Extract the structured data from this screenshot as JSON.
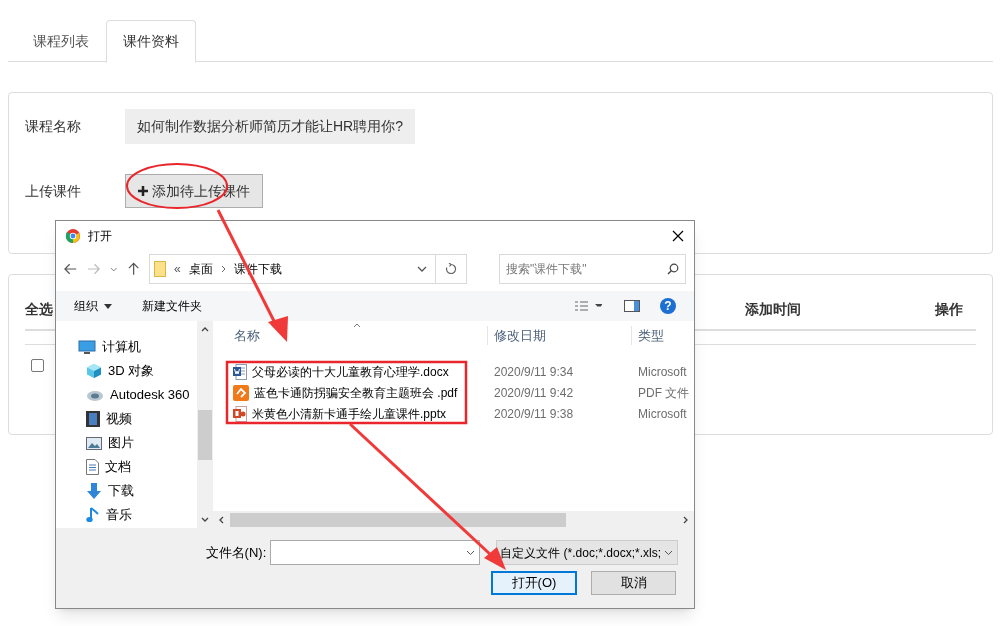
{
  "tabs": [
    {
      "label": "课程列表",
      "selected": false
    },
    {
      "label": "课件资料",
      "selected": true
    }
  ],
  "form": {
    "course_label": "课程名称",
    "course_value": "如何制作数据分析师简历才能让HR聘用你?",
    "upload_label": "上传课件",
    "add_button": "添加待上传课件"
  },
  "table": {
    "columns": [
      "全选",
      "添加时间",
      "操作"
    ],
    "rows": [
      {
        "checked": false
      }
    ]
  },
  "dialog": {
    "title": "打开",
    "path_prefix": "«",
    "path": [
      "桌面",
      "课件下载"
    ],
    "search_placeholder": "搜索\"课件下载\"",
    "organize": "组织",
    "help": "?",
    "new_folder": "新建文件夹",
    "sidebar": [
      {
        "label": "计算机",
        "kind": "computer",
        "children": [
          {
            "label": "3D 对象",
            "kind": "cube"
          },
          {
            "label": "Autodesk 360",
            "kind": "cloud"
          },
          {
            "label": "视频",
            "kind": "film"
          },
          {
            "label": "图片",
            "kind": "picture"
          },
          {
            "label": "文档",
            "kind": "document"
          },
          {
            "label": "下载",
            "kind": "download"
          },
          {
            "label": "音乐",
            "kind": "music"
          }
        ]
      }
    ],
    "columns": [
      "名称",
      "修改日期",
      "类型"
    ],
    "files": [
      {
        "name": "父母必读的十大儿童教育心理学.docx",
        "date": "2020/9/11 9:34",
        "type": "Microsoft",
        "kind": "word"
      },
      {
        "name": "蓝色卡通防拐骗安全教育主题班会 .pdf",
        "date": "2020/9/11 9:42",
        "type": "PDF 文件",
        "kind": "pdf"
      },
      {
        "name": "米黄色小清新卡通手绘儿童课件.pptx",
        "date": "2020/9/11 9:38",
        "type": "Microsoft",
        "kind": "ppt"
      }
    ],
    "filename_label": "文件名(N):",
    "filter": "自定义文件 (*.doc;*.docx;*.xls;",
    "open_button": "打开(O)",
    "cancel_button": "取消"
  }
}
